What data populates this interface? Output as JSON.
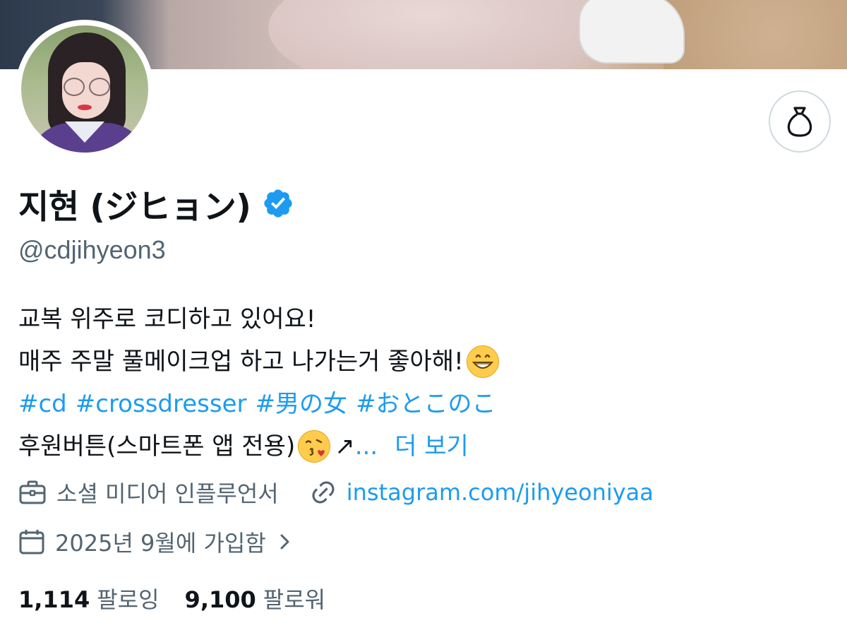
{
  "profile": {
    "display_name": "지현 (ジヒョン)",
    "handle": "@cdjihyeon3",
    "verified": true,
    "avatar_alt": "profile photo",
    "tip_icon": "money-bag-icon"
  },
  "bio": {
    "line1": "교복 위주로 코디하고 있어요!",
    "line2": "매주 주말 풀메이크업 하고 나가는거 좋아해!",
    "line2_emoji": "grinning-face-emoji",
    "hashtags": [
      "#cd",
      "#crossdresser",
      "#男の女",
      "#おとこのこ"
    ],
    "line4": "후원버튼(스마트폰 앱 전용)",
    "line4_emoji": "face-blowing-kiss-emoji",
    "line4_arrow": "↗",
    "ellipsis": "...",
    "more_label": "더 보기"
  },
  "meta": {
    "category": "소셜 미디어 인플루언서",
    "category_icon": "briefcase-icon",
    "link": "instagram.com/jihyeoniyaa",
    "link_icon": "link-icon",
    "joined": "2025년 9월에 가입함",
    "joined_icon": "calendar-icon",
    "joined_chevron": "›"
  },
  "stats": {
    "following_count": "1,114",
    "following_label": "팔로잉",
    "followers_count": "9,100",
    "followers_label": "팔로워"
  },
  "colors": {
    "accent": "#1d9bf0",
    "secondary_text": "#536471",
    "primary_text": "#0f1419",
    "verified": "#1d9bf0"
  }
}
